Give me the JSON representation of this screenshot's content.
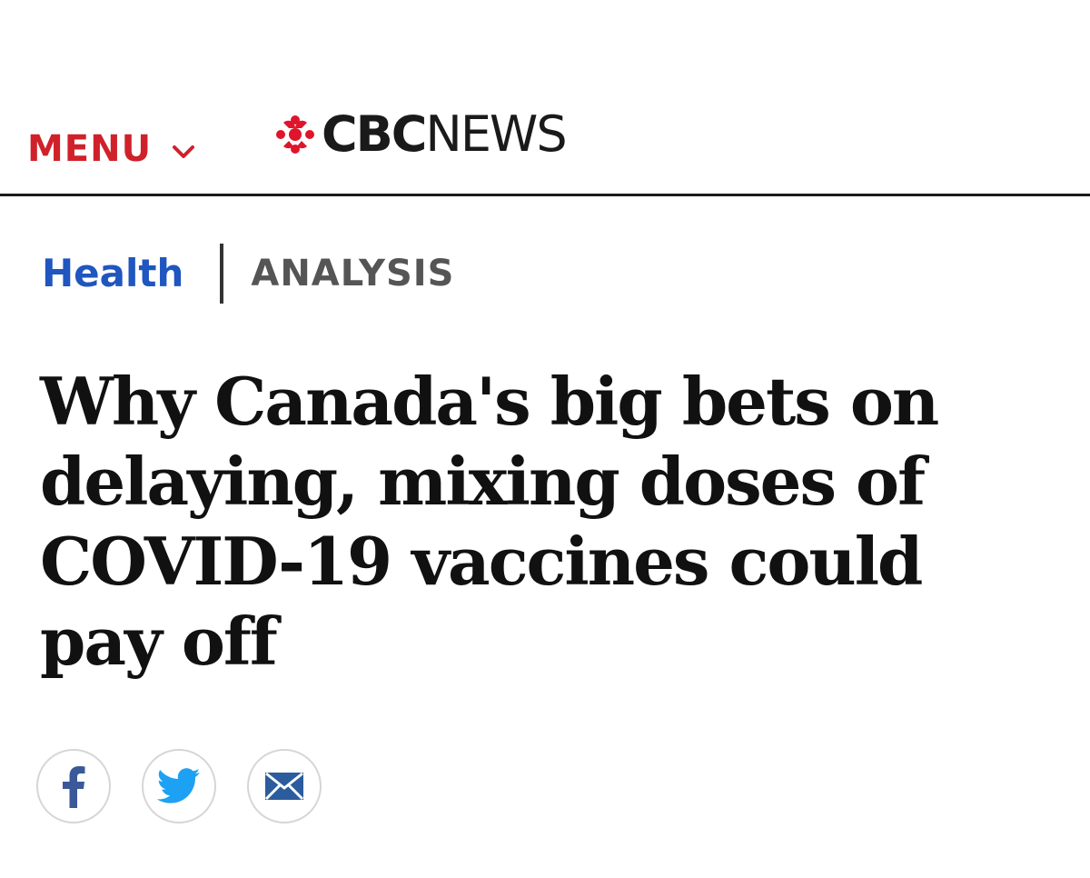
{
  "header": {
    "menu_label": "MENU",
    "logo_cbc": "CBC",
    "logo_news": "NEWS",
    "menu_color": "#d0212a",
    "logo_gem_color": "#e0142b"
  },
  "article": {
    "section": "Health",
    "tag": "ANALYSIS",
    "headline": "Why Canada's big bets on delaying, mixing doses of COVID-19 vaccines could pay off",
    "section_color": "#1f56bf"
  },
  "share": {
    "buttons": [
      {
        "icon": "facebook-icon",
        "color": "#3b5998"
      },
      {
        "icon": "twitter-icon",
        "color": "#1da1f2"
      },
      {
        "icon": "email-icon",
        "color": "#2b5c9e"
      }
    ]
  }
}
